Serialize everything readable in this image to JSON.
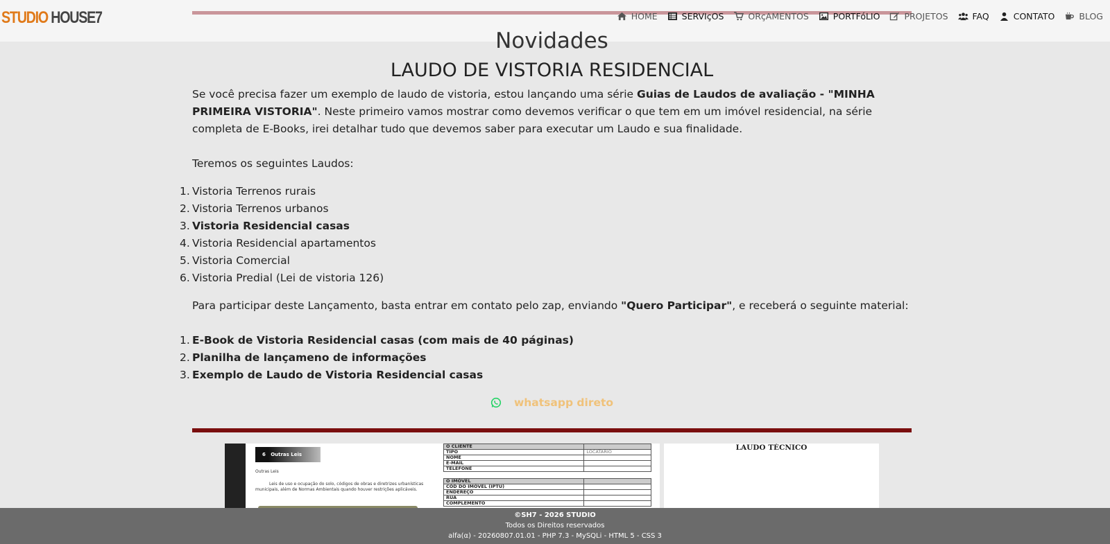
{
  "brand": {
    "part1": "STUDIO",
    "part2": "HOUSE7"
  },
  "nav": [
    {
      "label": "HOME",
      "icon": "home-icon"
    },
    {
      "label": "SERVIçOS",
      "icon": "list-icon"
    },
    {
      "label": "ORçAMENTOS",
      "icon": "cart-icon"
    },
    {
      "label": "PORTFóLIO",
      "icon": "image-icon"
    },
    {
      "label": "PROJETOS",
      "icon": "edit-icon"
    },
    {
      "label": "FAQ",
      "icon": "users-icon"
    },
    {
      "label": "CONTATO",
      "icon": "user-icon"
    },
    {
      "label": "BLOG",
      "icon": "coffee-icon"
    }
  ],
  "section_title": "Novidades",
  "article_title": "LAUDO DE VISTORIA RESIDENCIAL",
  "intro": {
    "text1": "Se você precisa fazer um exemplo de laudo de vistoria, estou lançando uma série ",
    "bold": "Guias de Laudos de avaliação - \"MINHA PRIMEIRA VISTORIA\"",
    "text2": ". Neste primeiro vamos mostrar como devemos verificar o que tem em um imóvel residencial, na série completa de E-Books, irei detalhar tudo que devemos saber para executar um Laudo e sua finalidade."
  },
  "lead": "Teremos os seguintes Laudos:",
  "laudos": [
    {
      "n": "1.",
      "label": "Vistoria Terrenos rurais",
      "bold": false
    },
    {
      "n": "2.",
      "label": "Vistoria Terrenos urbanos",
      "bold": false
    },
    {
      "n": "3.",
      "label": "Vistoria Residencial casas",
      "bold": true
    },
    {
      "n": "4.",
      "label": "Vistoria Residencial apartamentos",
      "bold": false
    },
    {
      "n": "5.",
      "label": "Vistoria Comercial",
      "bold": false
    },
    {
      "n": "6.",
      "label": "Vistoria Predial (Lei de vistoria 126)",
      "bold": false
    }
  ],
  "participate": {
    "text1": "Para participar deste Lançamento, basta entrar em contato pelo zap, enviando ",
    "bold": "\"Quero Participar\"",
    "text2": ", e receberá o seguinte material:"
  },
  "material": [
    {
      "n": "1.",
      "label": "E-Book de Vistoria Residencial casas (com mais de 40 páginas)"
    },
    {
      "n": "2.",
      "label": "Planilha de lançameno de informações"
    },
    {
      "n": "3.",
      "label": "Exemplo de Laudo de Vistoria Residencial casas"
    }
  ],
  "whatsapp_label": "whatsapp direto",
  "preview": {
    "ebook_chip_num": "6",
    "ebook_chip_title": "Outras Leis",
    "ebook_heading": "Outras Leis",
    "ebook_line1": "Leis de uso e ocupação do solo, códigos de obras e diretrizes urbanísticas",
    "ebook_line2": "municipais, além de Normas Ambientais quando houver restrições aplicáveis.",
    "sheet_rows1": [
      [
        "O CLIENTE",
        ""
      ],
      [
        "TIPO",
        "LOCATÁRIO"
      ],
      [
        "NOME",
        ""
      ],
      [
        "E-MAIL",
        ""
      ],
      [
        "TELEFONE",
        ""
      ]
    ],
    "sheet_rows2": [
      [
        "O IMÓVEL",
        ""
      ],
      [
        "CÓD DO IMÓVEL (IPTU)",
        ""
      ],
      [
        "ENDEREÇO",
        ""
      ],
      [
        "RUA",
        ""
      ],
      [
        "COMPLEMENTO",
        ""
      ]
    ],
    "report_title": "LAUDO TÉCNICO"
  },
  "footer": {
    "line1": "©SH7 - 2026 STUDIO",
    "line2": "Todos os Direitos reservados",
    "line3": "alfa(α) - 20260807.01.01 - PHP 7.3 - MySQLi - HTML 5 - CSS 3"
  },
  "colors": {
    "brand_orange": "#e07a1a",
    "divider": "#7a0e0e",
    "whatsapp_green": "#25d366",
    "whatsapp_text": "#f0c27a"
  }
}
